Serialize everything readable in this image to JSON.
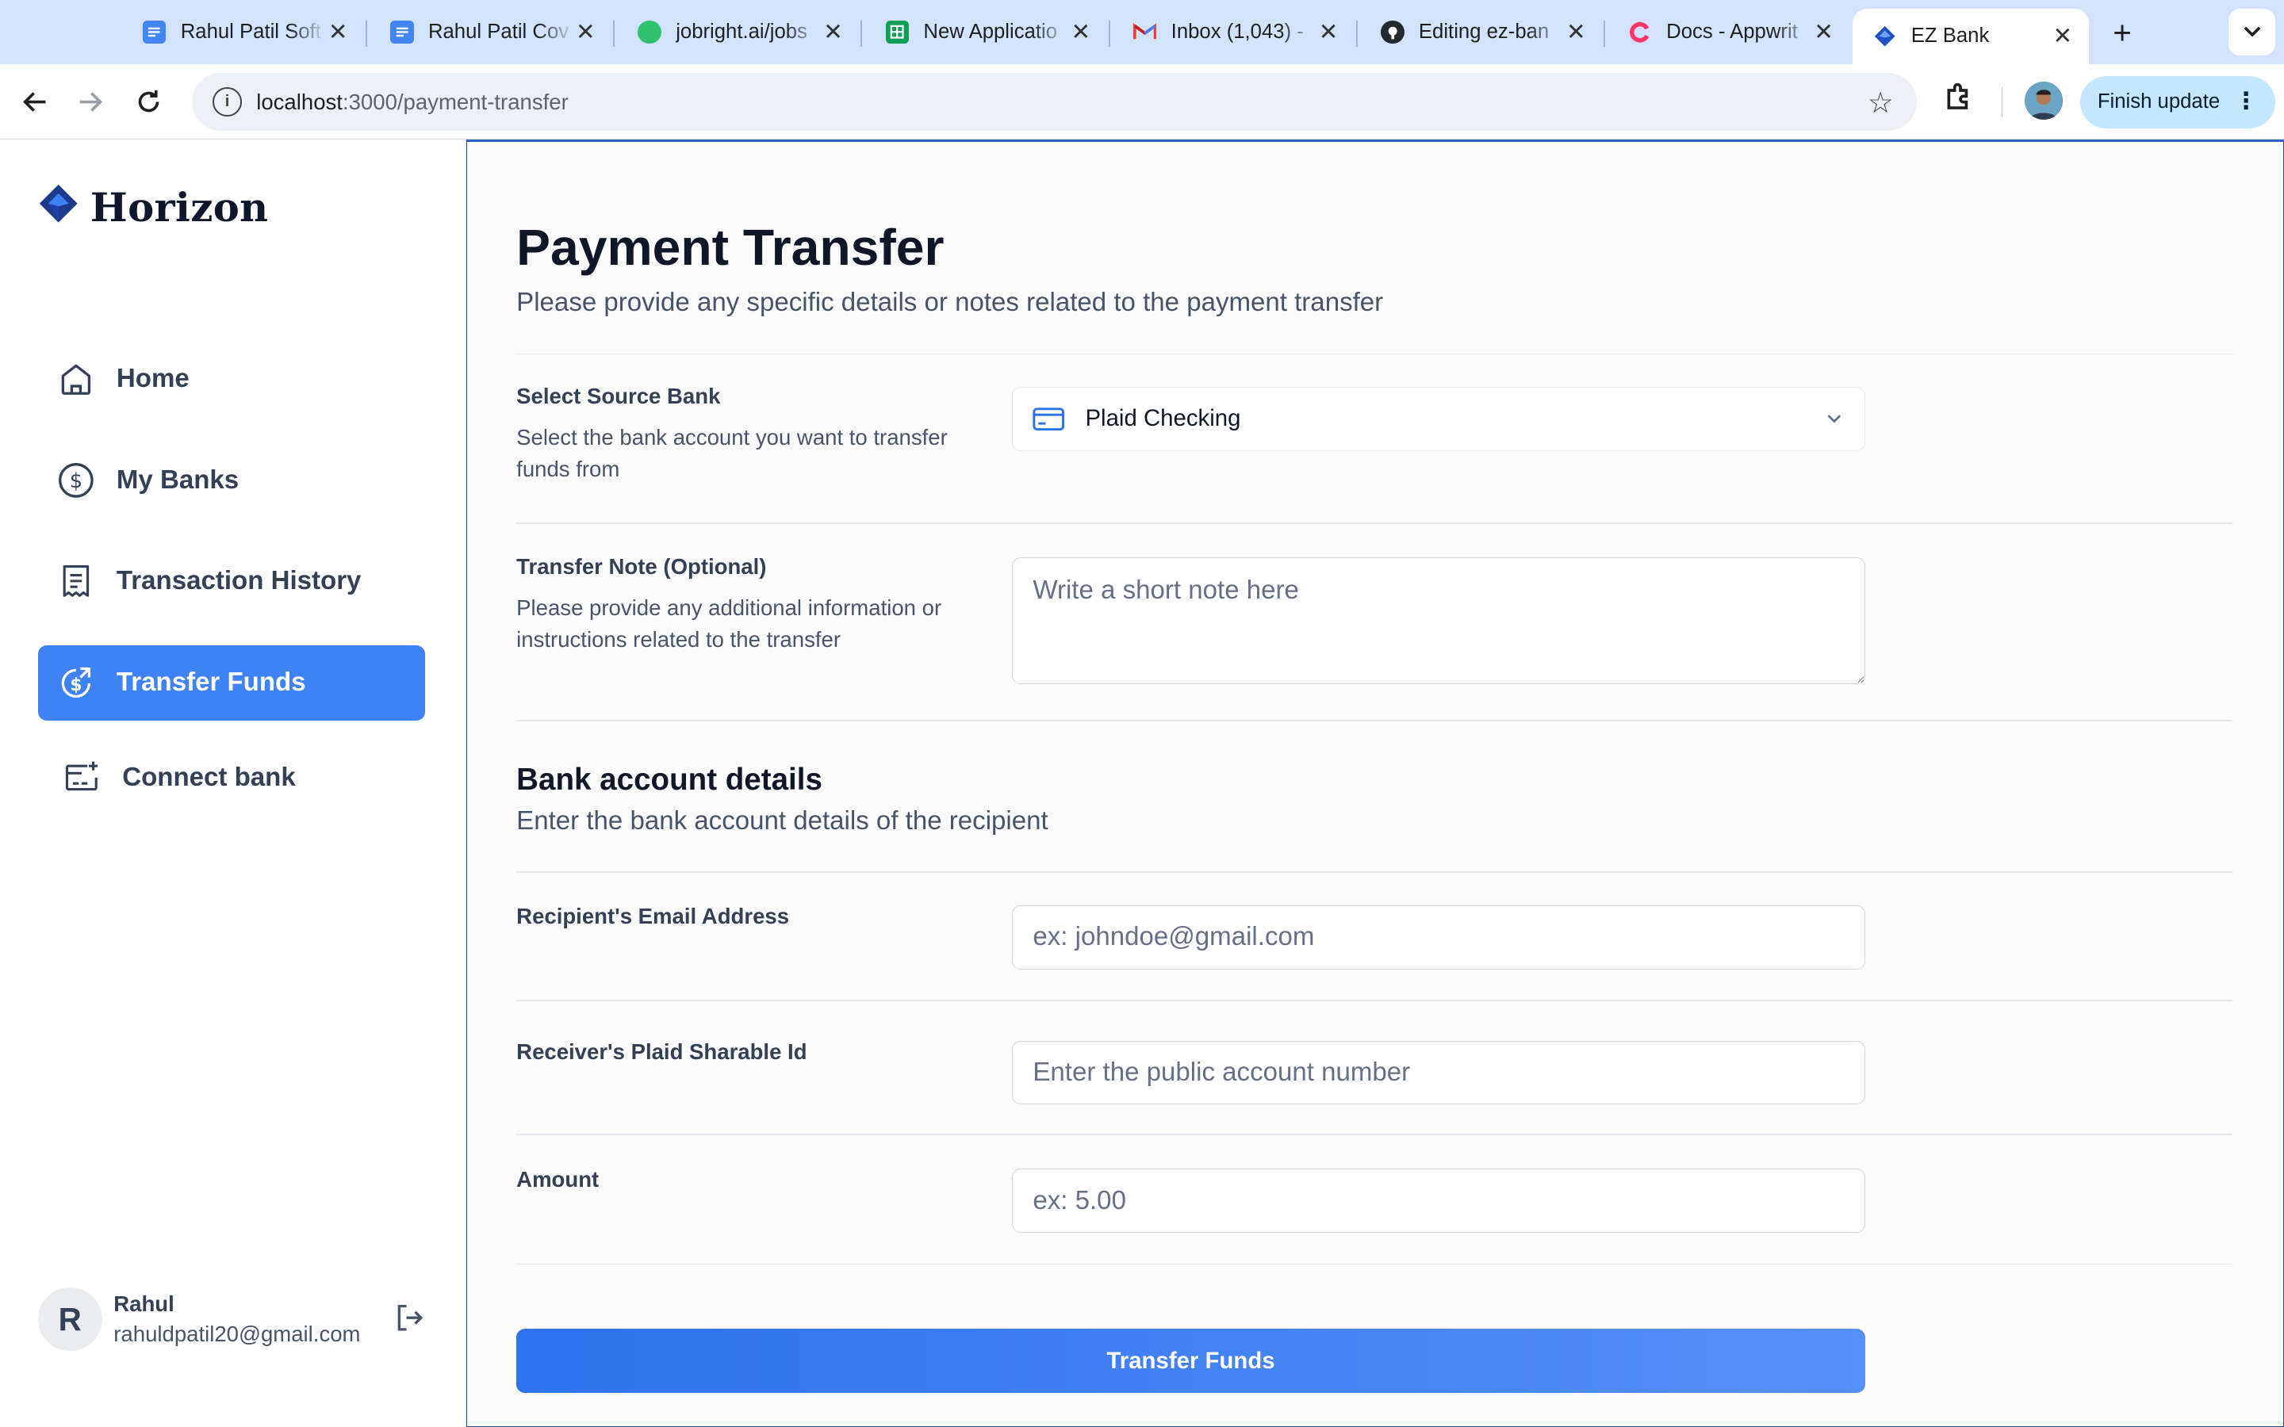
{
  "browser": {
    "tabs": [
      {
        "title": "Rahul Patil Soft",
        "favicon": "google-docs-icon",
        "color": "#4285f4"
      },
      {
        "title": "Rahul Patil Cov",
        "favicon": "google-docs-icon",
        "color": "#4285f4"
      },
      {
        "title": "jobright.ai/jobs",
        "favicon": "jobright-icon",
        "color": "#2ec26d"
      },
      {
        "title": "New Applicatio",
        "favicon": "google-sheets-icon",
        "color": "#0f9d58"
      },
      {
        "title": "Inbox (1,043) -",
        "favicon": "gmail-icon",
        "color": "#ea4335"
      },
      {
        "title": "Editing ez-ban",
        "favicon": "github-icon",
        "color": "#24292f"
      },
      {
        "title": "Docs - Appwrit",
        "favicon": "appwrite-icon",
        "color": "#fd366e"
      },
      {
        "title": "EZ Bank",
        "favicon": "horizon-icon",
        "color": "#1e50c8",
        "active": true
      }
    ],
    "url_host": "localhost",
    "url_path": ":3000/payment-transfer",
    "update_label": "Finish update"
  },
  "sidebar": {
    "logo_text": "Horizon",
    "items": [
      {
        "label": "Home",
        "icon": "home-icon",
        "active": false
      },
      {
        "label": "My Banks",
        "icon": "dollar-circle-icon",
        "active": false
      },
      {
        "label": "Transaction History",
        "icon": "receipt-icon",
        "active": false
      },
      {
        "label": "Transfer Funds",
        "icon": "money-send-icon",
        "active": true
      },
      {
        "label": "Connect bank",
        "icon": "card-add-icon",
        "active": false
      }
    ],
    "user": {
      "initial": "R",
      "name": "Rahul",
      "email": "rahuldpatil20@gmail.com"
    }
  },
  "main": {
    "title": "Payment Transfer",
    "subtitle": "Please provide any specific details or notes related to the payment transfer",
    "source_bank": {
      "label": "Select Source Bank",
      "description": "Select the bank account you want to transfer funds from",
      "selected": "Plaid Checking"
    },
    "note": {
      "label": "Transfer Note (Optional)",
      "description": "Please provide any additional information or instructions related to the transfer",
      "placeholder": "Write a short note here"
    },
    "bank_details": {
      "title": "Bank account details",
      "subtitle": "Enter the bank account details of the recipient"
    },
    "email": {
      "label": "Recipient's Email Address",
      "placeholder": "ex: johndoe@gmail.com"
    },
    "sharable_id": {
      "label": "Receiver's Plaid Sharable Id",
      "placeholder": "Enter the public account number"
    },
    "amount": {
      "label": "Amount",
      "placeholder": "ex: 5.00"
    },
    "submit_label": "Transfer Funds"
  },
  "colors": {
    "accent": "#3f82f6",
    "tabbar": "#d3e3fd"
  }
}
